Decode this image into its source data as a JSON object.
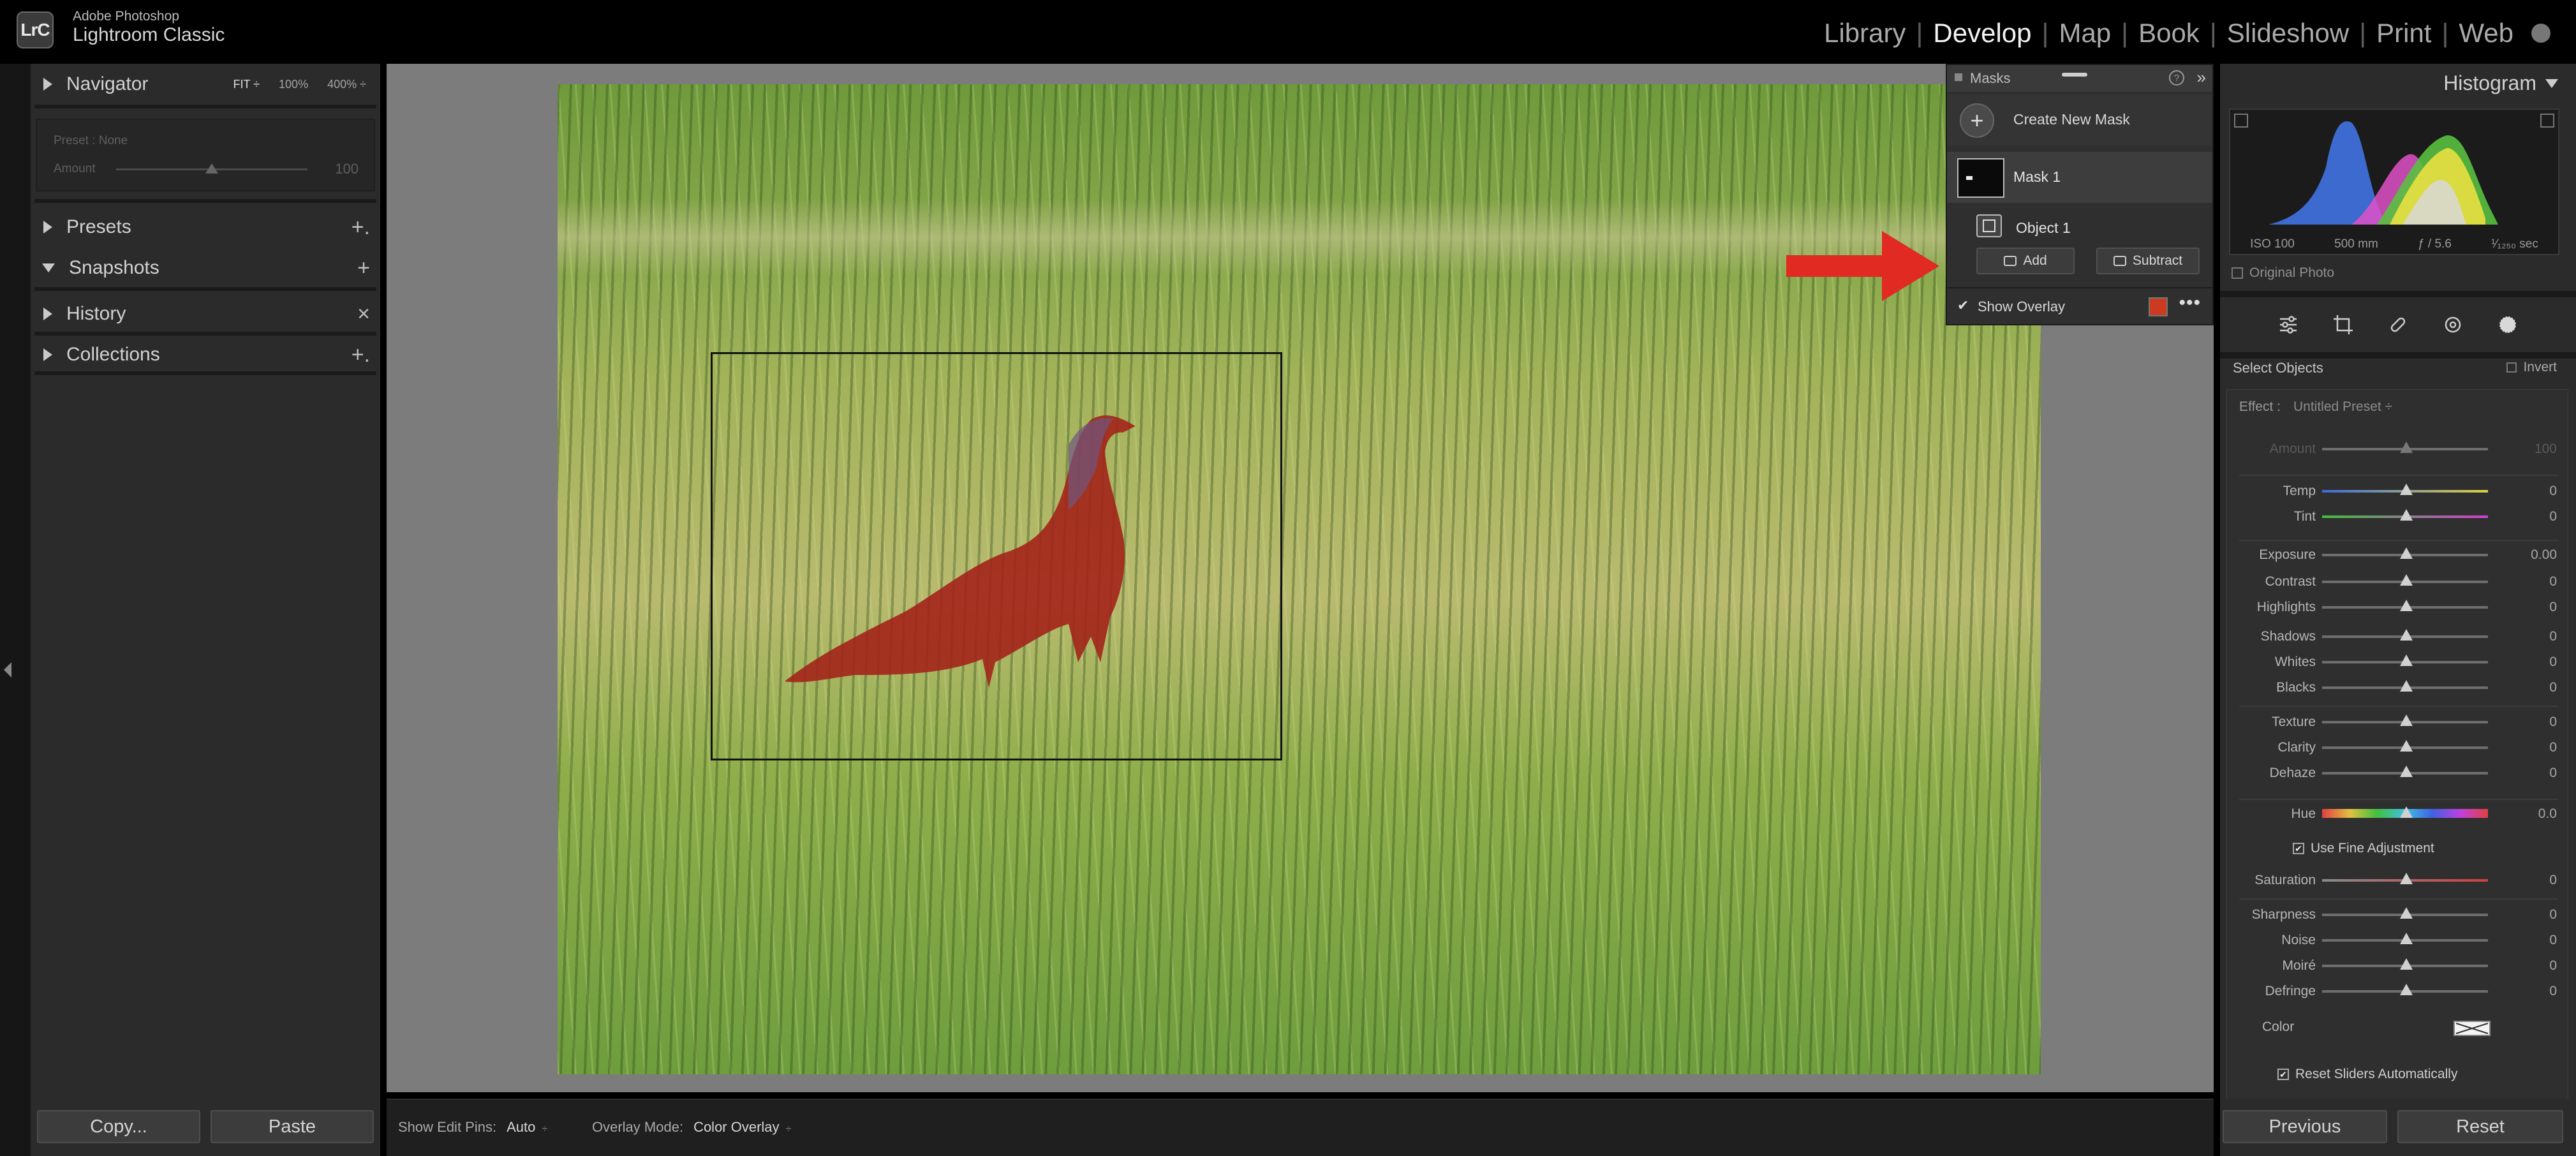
{
  "app": {
    "brand_small": "Adobe Photoshop",
    "brand_large": "Lightroom Classic",
    "badge": "LrC"
  },
  "modules": [
    {
      "label": "Library",
      "active": false
    },
    {
      "label": "Develop",
      "active": true
    },
    {
      "label": "Map",
      "active": false
    },
    {
      "label": "Book",
      "active": false
    },
    {
      "label": "Slideshow",
      "active": false
    },
    {
      "label": "Print",
      "active": false
    },
    {
      "label": "Web",
      "active": false
    }
  ],
  "left_panel": {
    "navigator": {
      "title": "Navigator",
      "fit": "FIT ÷",
      "zoom1": "100%",
      "zoom2": "400% ÷"
    },
    "preview": {
      "preset": "Preset : None",
      "amount_label": "Amount",
      "amount_value": "100"
    },
    "presets": {
      "title": "Presets",
      "action": "+."
    },
    "snapshots": {
      "title": "Snapshots",
      "action": "+"
    },
    "history": {
      "title": "History",
      "action": "×"
    },
    "collections": {
      "title": "Collections",
      "action": "+."
    },
    "copy_label": "Copy...",
    "paste_label": "Paste"
  },
  "masks_panel": {
    "title": "Masks",
    "help": "?",
    "collapse": "»",
    "create_new_mask": "Create New Mask",
    "mask_name": "Mask 1",
    "object_name": "Object 1",
    "add_label": "Add",
    "subtract_label": "Subtract",
    "show_overlay_label": "Show Overlay",
    "show_overlay_checked": true,
    "overlay_color": "#cc3b21",
    "more": "•••"
  },
  "right_panel": {
    "histogram_title": "Histogram",
    "histogram_info": {
      "iso": "ISO 100",
      "focal": "500 mm",
      "aperture": "ƒ / 5.6",
      "shutter": "¹⁄₁₂₅₀ sec"
    },
    "original_photo": "Original Photo",
    "select_objects": "Select Objects",
    "invert": "Invert",
    "effect_label": "Effect :",
    "effect_preset": "Untitled Preset ÷",
    "sliders": [
      {
        "label": "Amount",
        "value": "100",
        "dim": true
      },
      {
        "label": "Temp",
        "value": "0",
        "dim": false
      },
      {
        "label": "Tint",
        "value": "0",
        "dim": false
      },
      {
        "label": "Exposure",
        "value": "0.00",
        "dim": false
      },
      {
        "label": "Contrast",
        "value": "0",
        "dim": false
      },
      {
        "label": "Highlights",
        "value": "0",
        "dim": false
      },
      {
        "label": "Shadows",
        "value": "0",
        "dim": false
      },
      {
        "label": "Whites",
        "value": "0",
        "dim": false
      },
      {
        "label": "Blacks",
        "value": "0",
        "dim": false
      },
      {
        "label": "Texture",
        "value": "0",
        "dim": false
      },
      {
        "label": "Clarity",
        "value": "0",
        "dim": false
      },
      {
        "label": "Dehaze",
        "value": "0",
        "dim": false
      },
      {
        "label": "Hue",
        "value": "0.0",
        "dim": false
      },
      {
        "label": "Saturation",
        "value": "0",
        "dim": false
      },
      {
        "label": "Sharpness",
        "value": "0",
        "dim": false
      },
      {
        "label": "Noise",
        "value": "0",
        "dim": false
      },
      {
        "label": "Moiré",
        "value": "0",
        "dim": false
      },
      {
        "label": "Defringe",
        "value": "0",
        "dim": false
      }
    ],
    "use_fine_adjustment": "Use Fine Adjustment",
    "color_label": "Color",
    "reset_sliders": "Reset Sliders Automatically",
    "previous_label": "Previous",
    "reset_label": "Reset"
  },
  "bottom_toolbar": {
    "edit_pins_label": "Show Edit Pins:",
    "edit_pins_value": "Auto",
    "overlay_mode_label": "Overlay Mode:",
    "overlay_mode_value": "Color Overlay"
  },
  "colors": {
    "accent_red": "#e02a22",
    "mask_overlay": "#b2281c"
  }
}
